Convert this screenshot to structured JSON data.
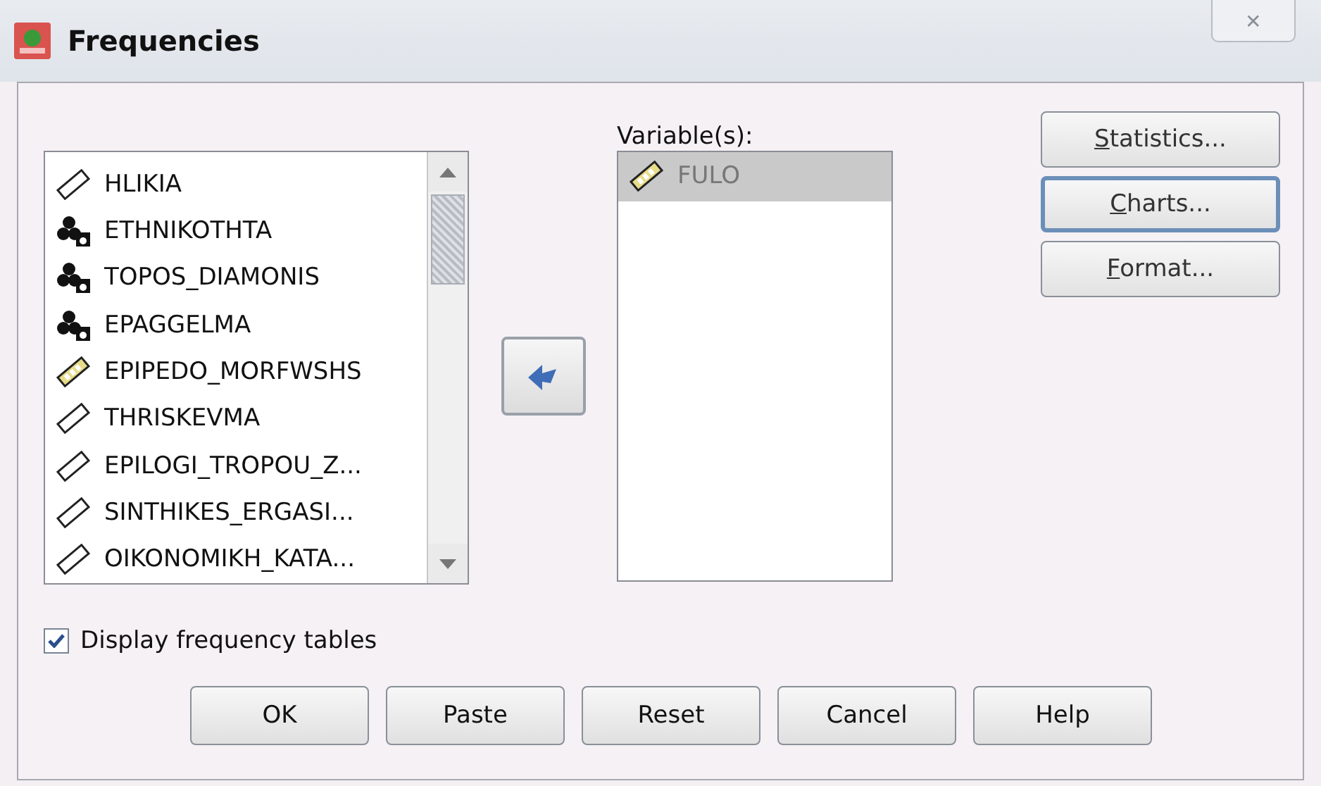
{
  "window": {
    "title": "Frequencies",
    "close": "✕"
  },
  "source_list": {
    "items": [
      {
        "name": "HLIKIA",
        "kind": "scale"
      },
      {
        "name": "ETHNIKOTHTA",
        "kind": "nominal"
      },
      {
        "name": "TOPOS_DIAMONIS",
        "kind": "nominal"
      },
      {
        "name": "EPAGGELMA",
        "kind": "nominal"
      },
      {
        "name": "EPIPEDO_MORFWSHS",
        "kind": "ordinal"
      },
      {
        "name": "THRISKEVMA",
        "kind": "scale"
      },
      {
        "name": "EPILOGI_TROPOU_Z...",
        "kind": "scale"
      },
      {
        "name": "SINTHIKES_ERGASI...",
        "kind": "scale"
      },
      {
        "name": "OIKONOMIKH_KATA...",
        "kind": "scale"
      }
    ]
  },
  "variables": {
    "label": "Variable(s):",
    "items": [
      {
        "name": "FULO",
        "kind": "ordinal",
        "selected": true
      }
    ]
  },
  "side_buttons": [
    {
      "label": "Statistics...",
      "mnemonic": true,
      "focused": false
    },
    {
      "label": "Charts...",
      "mnemonic": true,
      "focused": true
    },
    {
      "label": "Format...",
      "mnemonic": true,
      "focused": false
    }
  ],
  "display_frequency_tables": {
    "label": "Display frequency tables",
    "checked": true
  },
  "buttons": [
    "OK",
    "Paste",
    "Reset",
    "Cancel",
    "Help"
  ]
}
